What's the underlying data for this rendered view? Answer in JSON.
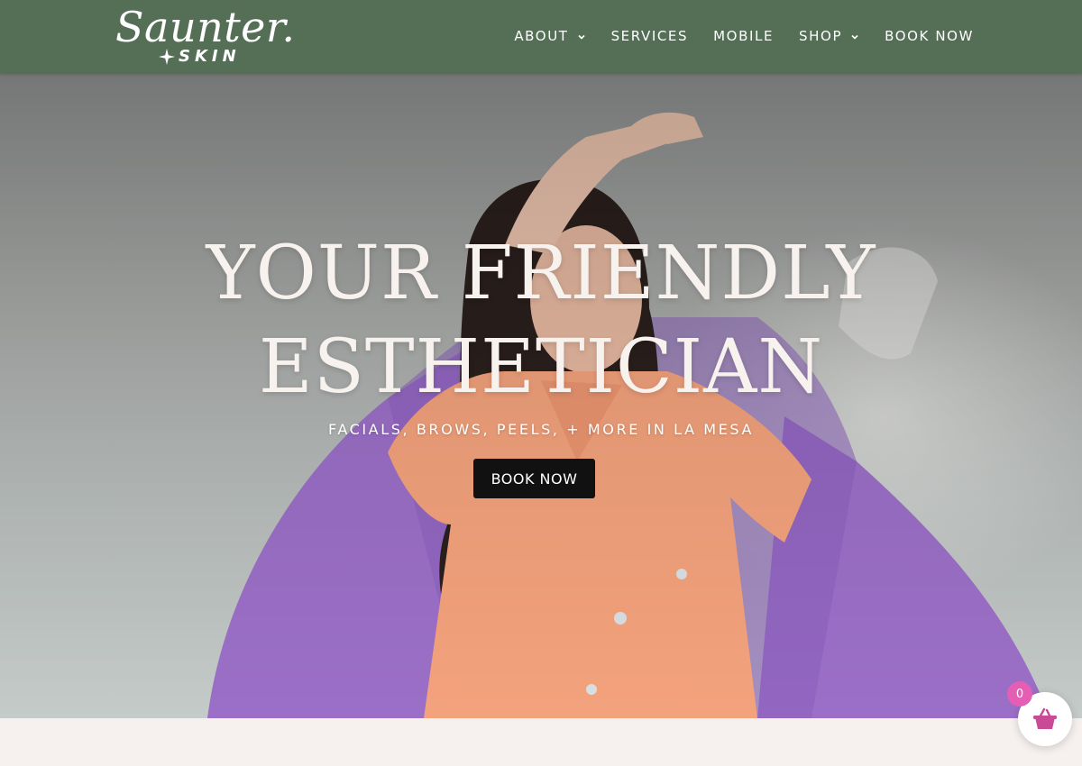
{
  "brand": {
    "logo_script": "Saunter.",
    "logo_sub": "SKIN"
  },
  "nav": {
    "items": [
      {
        "label": "ABOUT",
        "has_dropdown": true
      },
      {
        "label": "SERVICES",
        "has_dropdown": false
      },
      {
        "label": "MOBILE",
        "has_dropdown": false
      },
      {
        "label": "SHOP",
        "has_dropdown": true
      },
      {
        "label": "BOOK NOW",
        "has_dropdown": false
      }
    ]
  },
  "hero": {
    "title_line1": "YOUR FRIENDLY",
    "title_line2": "ESTHETICIAN",
    "subtitle": "FACIALS, BROWS, PEELS, + MORE IN LA MESA",
    "cta_label": "BOOK NOW"
  },
  "cart": {
    "count": "0",
    "icon": "basket-icon"
  },
  "colors": {
    "header_bg": "#556f57",
    "cta_bg": "#111111",
    "badge": "#e45fb4",
    "basket": "#c94a97",
    "page_bg": "#f6f1ee"
  }
}
